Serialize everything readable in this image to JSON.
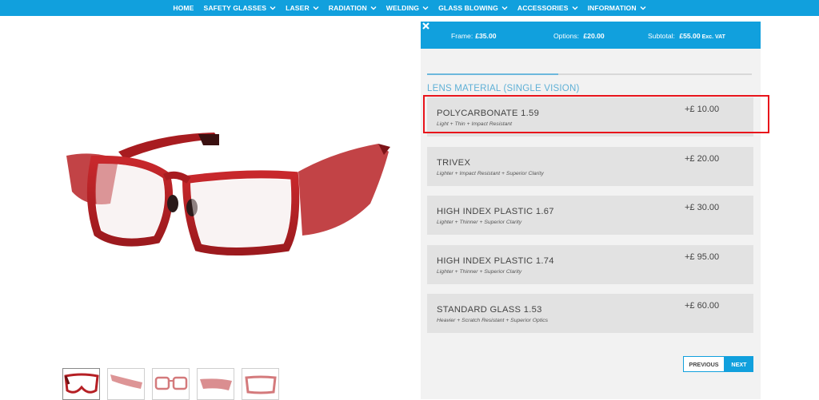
{
  "nav": {
    "items": [
      {
        "label": "HOME",
        "dropdown": false
      },
      {
        "label": "SAFETY GLASSES",
        "dropdown": true
      },
      {
        "label": "LASER",
        "dropdown": true
      },
      {
        "label": "RADIATION",
        "dropdown": true
      },
      {
        "label": "WELDING",
        "dropdown": true
      },
      {
        "label": "GLASS BLOWING",
        "dropdown": true
      },
      {
        "label": "ACCESSORIES",
        "dropdown": true
      },
      {
        "label": "INFORMATION",
        "dropdown": true
      }
    ]
  },
  "summary": {
    "frame_label": "Frame:",
    "frame_value": "£35.00",
    "options_label": "Options:",
    "options_value": "£20.00",
    "subtotal_label": "Subtotal:",
    "subtotal_value": "£55.00",
    "subtotal_note": "Exc. VAT"
  },
  "section": {
    "title": "LENS MATERIAL (SINGLE VISION)"
  },
  "options": [
    {
      "name": "POLYCARBONATE 1.59",
      "desc": "Light + Thin + Impact Resistant",
      "price": "+£ 10.00"
    },
    {
      "name": "TRIVEX",
      "desc": "Lighter + Impact Resistant + Superior Clarity",
      "price": "+£ 20.00"
    },
    {
      "name": "HIGH INDEX PLASTIC 1.67",
      "desc": "Lighter + Thinner + Superior Clarity",
      "price": "+£ 30.00"
    },
    {
      "name": "HIGH INDEX PLASTIC 1.74",
      "desc": "Lighter + Thinner + Superior Clarity",
      "price": "+£ 95.00"
    },
    {
      "name": "STANDARD GLASS 1.53",
      "desc": "Heavier + Scratch Resistant + Superior Optics",
      "price": "+£ 60.00"
    }
  ],
  "pager": {
    "previous": "PREVIOUS",
    "next": "NEXT"
  },
  "colors": {
    "brand_blue": "#11a0dd",
    "highlight_red": "#e8141b",
    "frame_red": "#b51f24"
  },
  "icons": {
    "close": "close-icon",
    "dropdown": "chevron-down-icon"
  }
}
